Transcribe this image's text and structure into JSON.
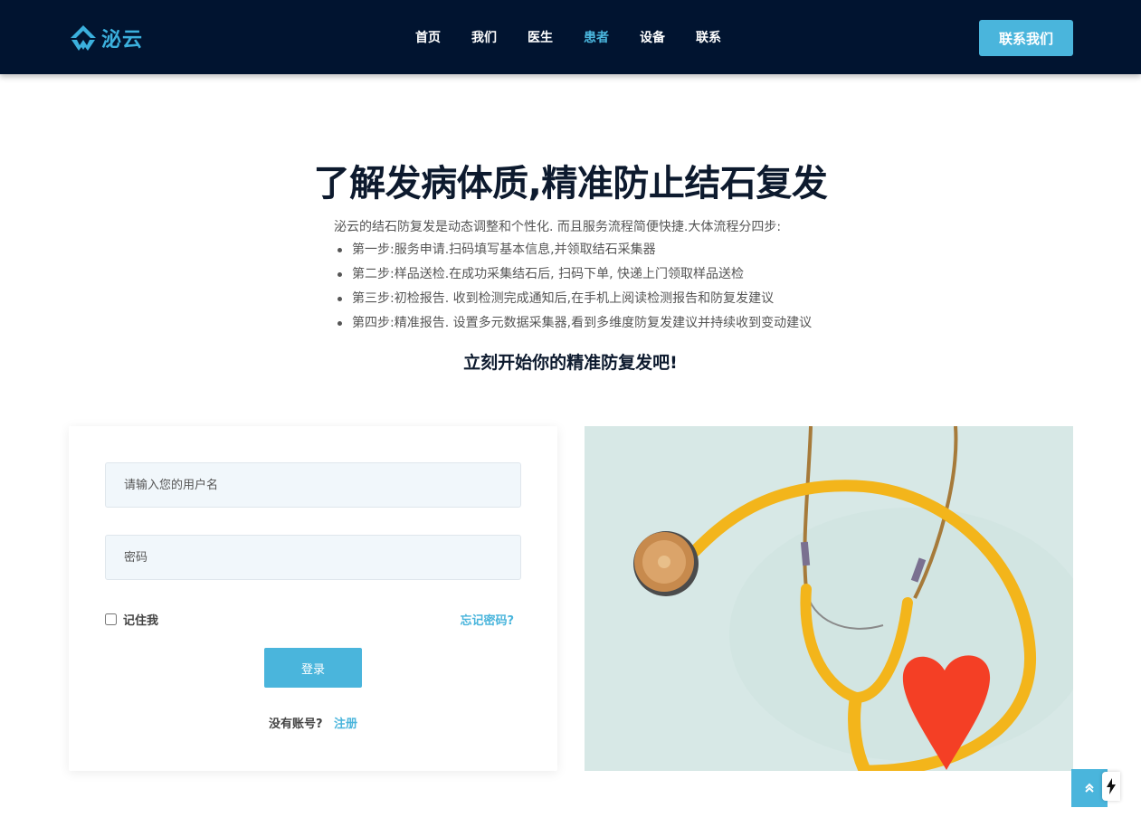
{
  "brand": {
    "name": "泌云",
    "accent": "#3bb0dd",
    "nav_bg": "#011430"
  },
  "nav": {
    "items": [
      {
        "label": "首页",
        "active": false
      },
      {
        "label": "我们",
        "active": false
      },
      {
        "label": "医生",
        "active": false
      },
      {
        "label": "患者",
        "active": true
      },
      {
        "label": "设备",
        "active": false
      },
      {
        "label": "联系",
        "active": false
      }
    ],
    "cta_label": "联系我们"
  },
  "hero": {
    "title": "了解发病体质,精准防止结石复发",
    "intro": "泌云的结石防复发是动态调整和个性化. 而且服务流程简便快捷.大体流程分四步:",
    "steps": [
      "第一步:服务申请.扫码填写基本信息,并领取结石采集器",
      "第二步:样品送检.在成功采集结石后, 扫码下单, 快递上门领取样品送检",
      "第三步:初检报告. 收到检测完成通知后,在手机上阅读检测报告和防复发建议",
      "第四步:精准报告. 设置多元数据采集器,看到多维度防复发建议并持续收到变动建议"
    ],
    "subtitle": "立刻开始你的精准防复发吧!"
  },
  "login": {
    "username_placeholder": "请输入您的用户名",
    "password_placeholder": "密码",
    "remember_label": "记住我",
    "forgot_label": "忘记密码?",
    "submit_label": "登录",
    "no_account_label": "没有账号?",
    "signup_label": "注册"
  },
  "icons": {
    "logo": "mountain-logo-icon",
    "scroll_top": "double-chevron-up-icon",
    "widget": "lightning-bolt-icon",
    "photo": "stethoscope-heart-photo"
  }
}
